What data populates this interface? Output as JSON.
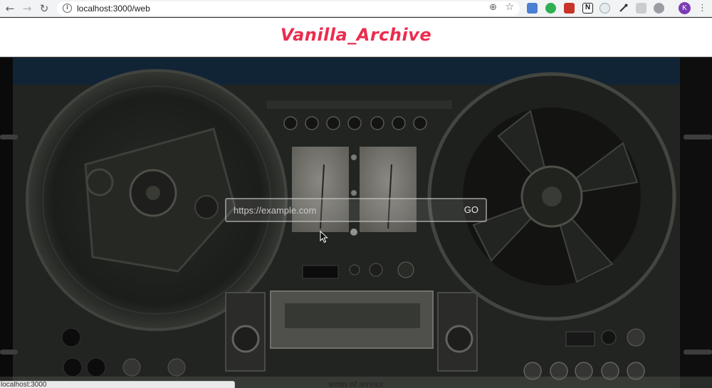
{
  "browser": {
    "url": "localhost:3000/web",
    "profile_initial": "K",
    "extension_icons": [
      "translate-icon",
      "evernote-icon",
      "pdf-icon",
      "notion-icon",
      "extension-circle-icon",
      "eyedropper-icon",
      "download-icon",
      "bug-icon"
    ],
    "status_text": "localhost:3000"
  },
  "site": {
    "title": "Vanilla_Archive",
    "brand_color": "#ea2d4e"
  },
  "search": {
    "placeholder": "https://example.com",
    "button_label": "GO"
  },
  "footer": {
    "link_label": "terms of service"
  }
}
